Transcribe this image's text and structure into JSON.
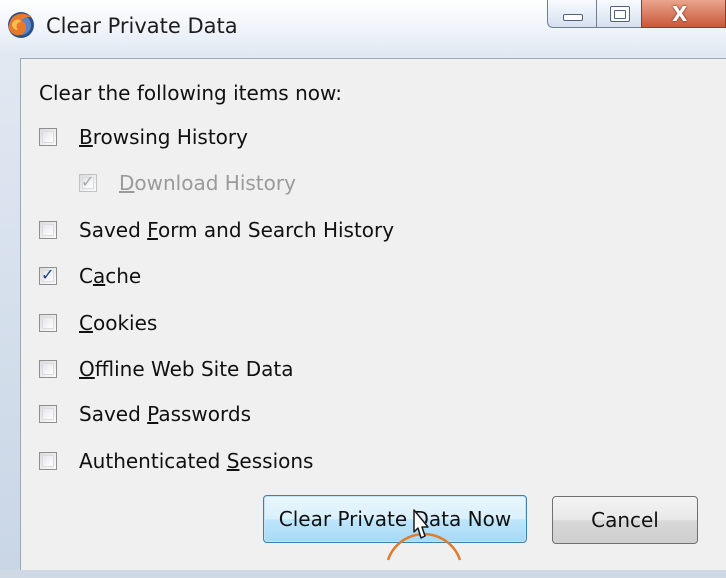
{
  "window": {
    "title": "Clear Private Data",
    "app_icon": "firefox-icon"
  },
  "caption_buttons": {
    "minimize_icon": "minimize-icon",
    "maximize_icon": "maximize-icon",
    "close_label": "X",
    "close_icon": "close-icon"
  },
  "dialog": {
    "heading": "Clear the following items now:",
    "items": [
      {
        "pre": "",
        "key": "B",
        "post": "rowsing History",
        "checked": false,
        "disabled": false
      },
      {
        "pre": "",
        "key": "D",
        "post": "ownload History",
        "checked": true,
        "disabled": true
      },
      {
        "pre": "Saved ",
        "key": "F",
        "post": "orm and Search History",
        "checked": false,
        "disabled": false
      },
      {
        "pre": "C",
        "key": "a",
        "post": "che",
        "checked": true,
        "disabled": false
      },
      {
        "pre": "",
        "key": "C",
        "post": "ookies",
        "checked": false,
        "disabled": false
      },
      {
        "pre": "",
        "key": "O",
        "post": "ffline Web Site Data",
        "checked": false,
        "disabled": false
      },
      {
        "pre": "Saved ",
        "key": "P",
        "post": "asswords",
        "checked": false,
        "disabled": false
      },
      {
        "pre": "Authenticated ",
        "key": "S",
        "post": "essions",
        "checked": false,
        "disabled": false
      }
    ],
    "check_glyph": "✓"
  },
  "buttons": {
    "primary": "Clear Private Data Now",
    "cancel": "Cancel"
  },
  "colors": {
    "default_button_border": "#3c7fb1",
    "close_button": "#c9583a",
    "cursor_highlight": "#e07b2e"
  }
}
